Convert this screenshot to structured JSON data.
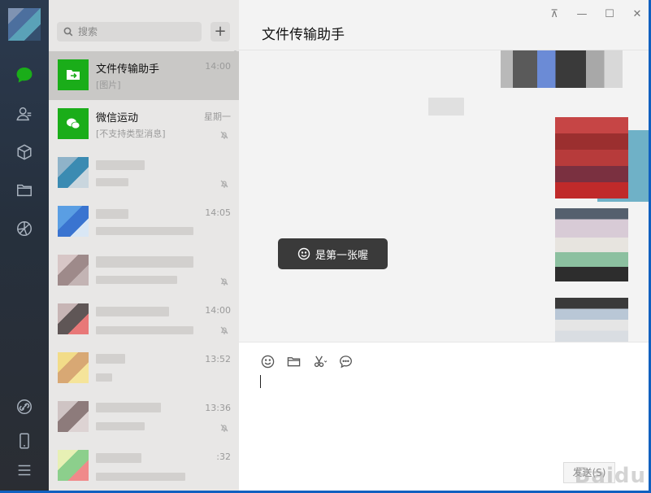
{
  "search": {
    "placeholder": "搜索"
  },
  "list": {
    "add_label": "+",
    "conversations": [
      {
        "name": "文件传输助手",
        "time": "14:00",
        "preview": "[图片]"
      },
      {
        "name": "微信运动",
        "time": "星期一",
        "preview": "[不支持类型消息]"
      },
      {
        "name": "",
        "time": "",
        "preview": ""
      },
      {
        "name": "",
        "time": "14:05",
        "preview": ""
      },
      {
        "name": "",
        "time": "",
        "preview": ""
      },
      {
        "name": "",
        "time": "14:00",
        "preview": ""
      },
      {
        "name": "",
        "time": "13:52",
        "preview": ""
      },
      {
        "name": "",
        "time": "13:36",
        "preview": ""
      },
      {
        "name": "",
        "time": ":32",
        "preview": ""
      }
    ]
  },
  "chat": {
    "title": "文件传输助手",
    "toast": "是第一张喔",
    "send_label": "发送(S)"
  },
  "window": {
    "pin": "⊼",
    "minimize": "—",
    "maximize": "☐",
    "close": "✕"
  },
  "watermark": "Baidu",
  "colors": {
    "accent": "#1aad19",
    "rail": "#2b3a4f",
    "list_bg": "#e8e7e6",
    "chat_bg": "#f3f3f3"
  },
  "icons": {
    "rail": [
      "chat-icon",
      "contacts-icon",
      "mini-program-icon",
      "files-icon",
      "moments-icon",
      "link-icon",
      "phone-icon",
      "menu-icon"
    ],
    "toolbar": [
      "emoji-icon",
      "folder-icon",
      "scissors-icon",
      "chat-history-icon"
    ]
  }
}
